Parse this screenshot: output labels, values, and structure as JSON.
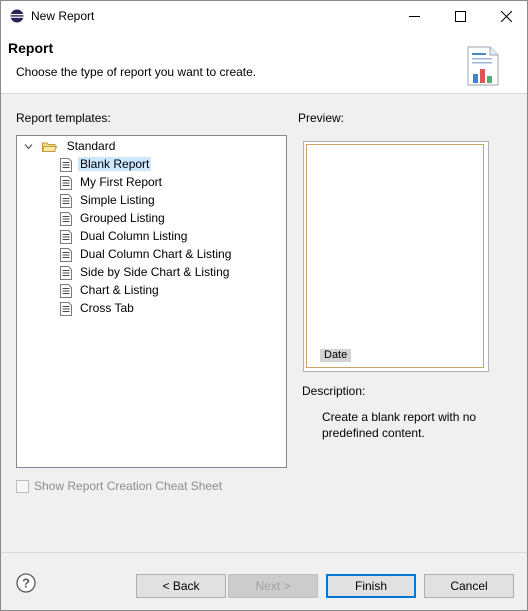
{
  "window": {
    "title": "New Report",
    "icon": "eclipse-icon"
  },
  "banner": {
    "title": "Report",
    "description": "Choose the type of report you want to create.",
    "icon": "report-wizard-icon"
  },
  "templates": {
    "label": "Report templates:",
    "folder": "Standard",
    "folder_expanded": true,
    "items": [
      {
        "label": "Blank Report",
        "selected": true
      },
      {
        "label": "My First Report",
        "selected": false
      },
      {
        "label": "Simple Listing",
        "selected": false
      },
      {
        "label": "Grouped Listing",
        "selected": false
      },
      {
        "label": "Dual Column Listing",
        "selected": false
      },
      {
        "label": "Dual Column Chart & Listing",
        "selected": false
      },
      {
        "label": "Side by Side Chart & Listing",
        "selected": false
      },
      {
        "label": "Chart & Listing",
        "selected": false
      },
      {
        "label": "Cross Tab",
        "selected": false
      }
    ]
  },
  "preview": {
    "label": "Preview:",
    "date_label": "Date"
  },
  "description": {
    "label": "Description:",
    "text": "Create a blank report with no predefined content."
  },
  "cheat_sheet": {
    "label": "Show Report Creation Cheat Sheet",
    "checked": false,
    "enabled": false
  },
  "buttons": {
    "back": "< Back",
    "next": "Next >",
    "finish": "Finish",
    "cancel": "Cancel"
  },
  "colors": {
    "selection": "#cce8ff",
    "default_button_border": "#0078d7",
    "folder": "#dcb35c"
  }
}
